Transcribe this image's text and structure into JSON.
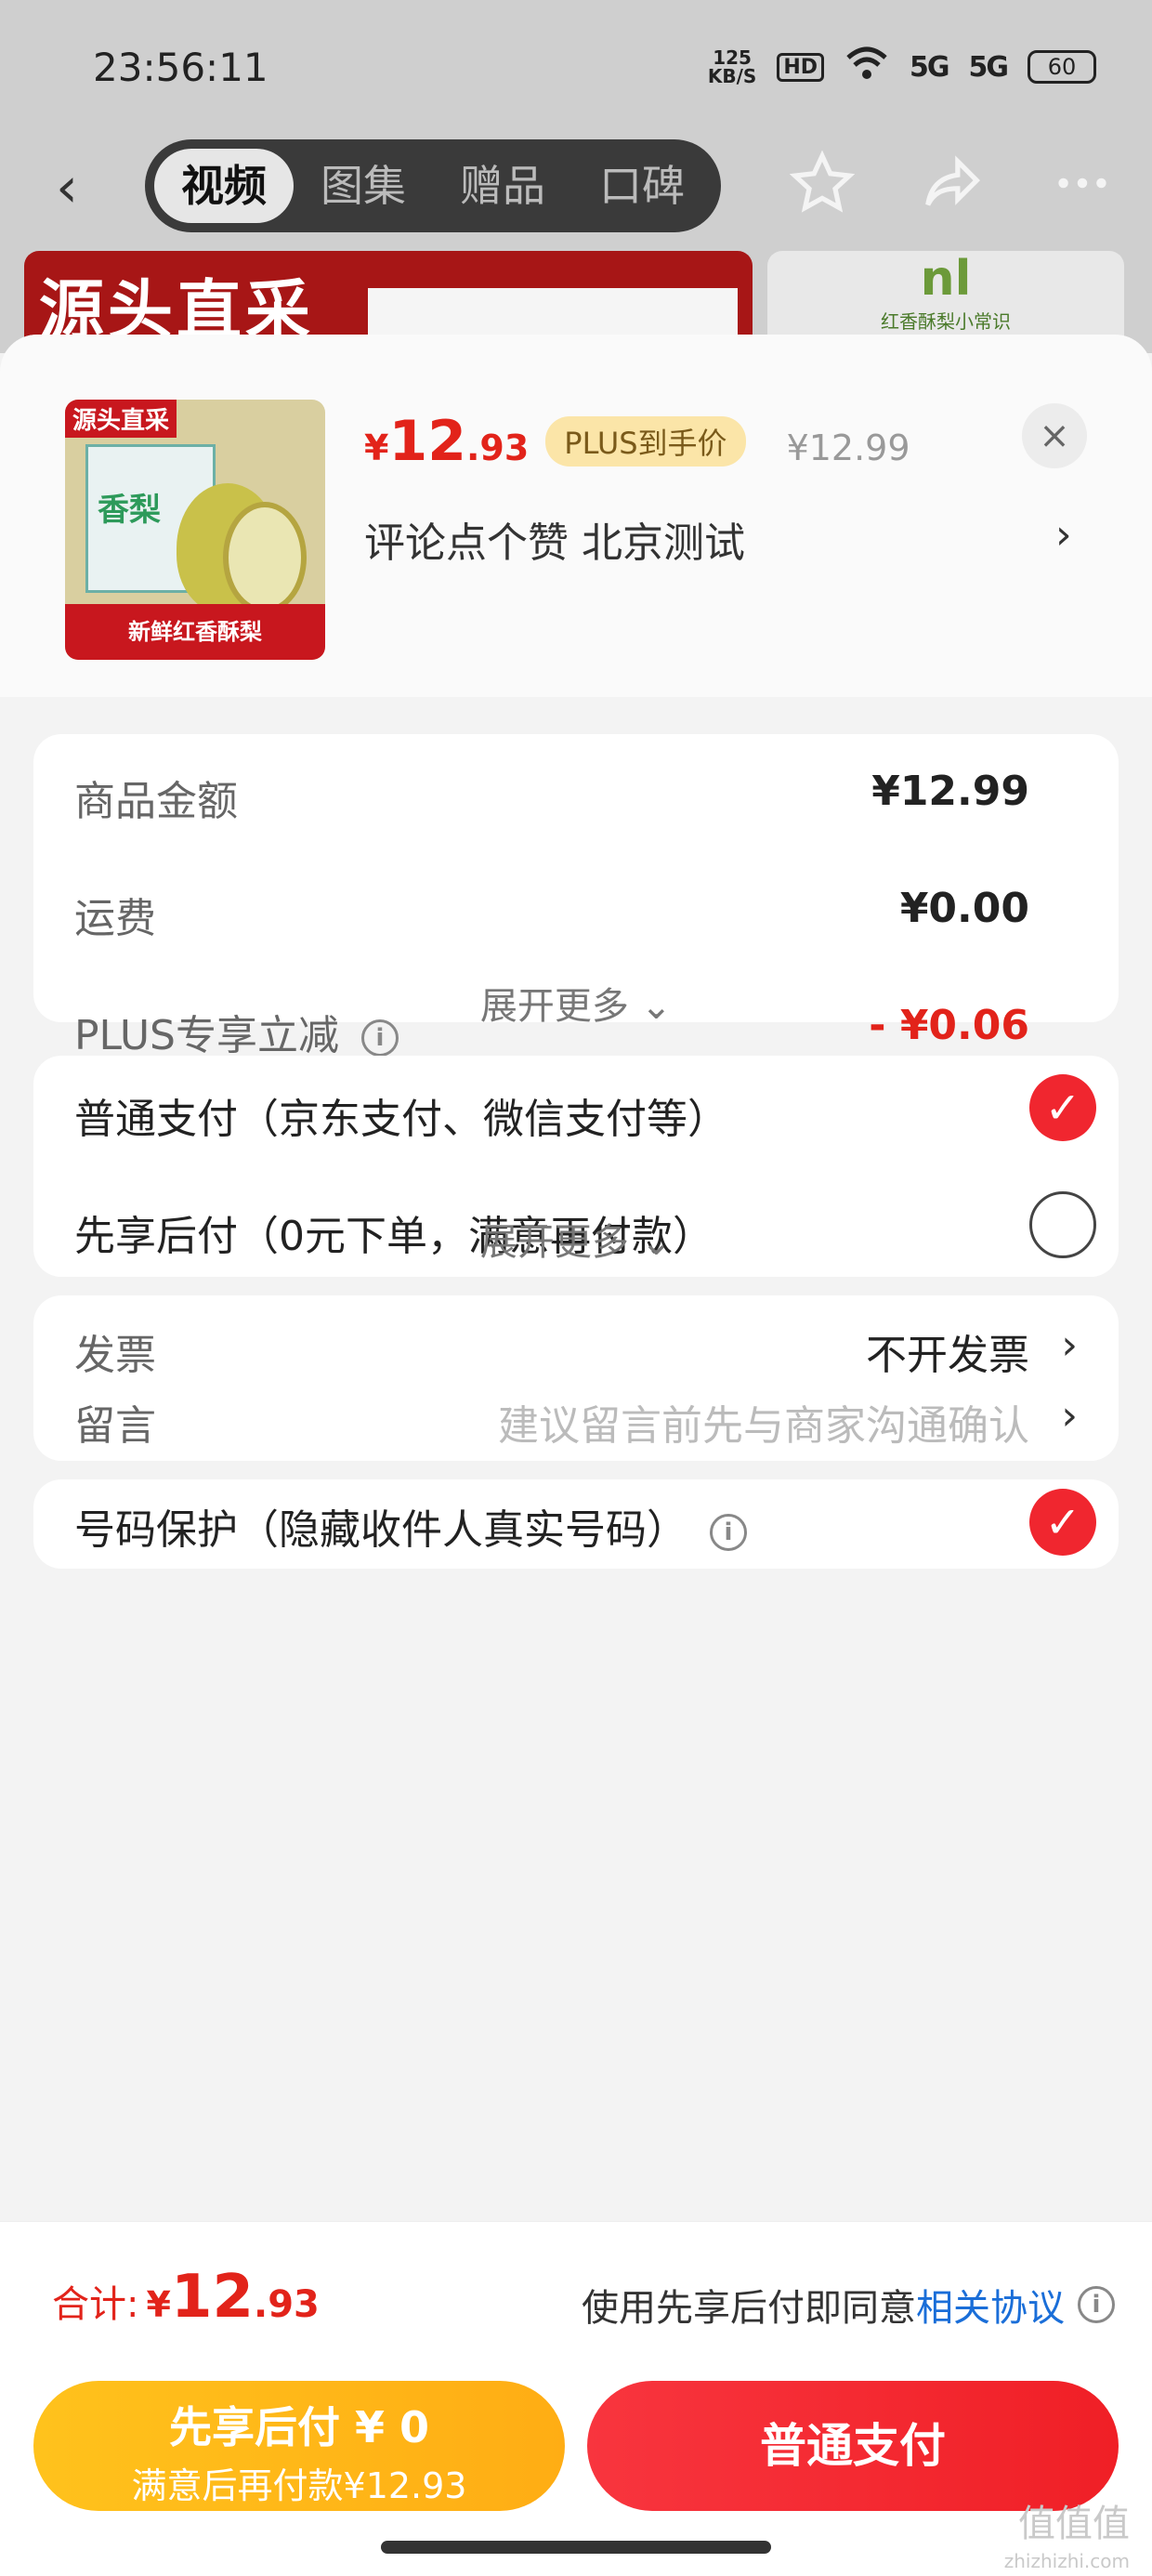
{
  "status_bar": {
    "time": "23:56:11",
    "net_speed_value": "125",
    "net_speed_unit": "KB/S",
    "hd": "HD",
    "signal1": "5G",
    "signal2": "5G",
    "battery": "60"
  },
  "nav": {
    "back": "‹",
    "tabs": [
      "视频",
      "图集",
      "赠品",
      "口碑"
    ],
    "active_tab": "视频"
  },
  "banner": {
    "left_text": "源头直采",
    "right_logo": "nl",
    "right_text": "红香酥梨小常识"
  },
  "product": {
    "thumb_tag": "源头直采",
    "thumb_box_text": "香梨",
    "thumb_bottom": "新鲜红香酥梨",
    "price_symbol": "¥",
    "price_int": "12",
    "price_dec": ".93",
    "plus_badge": "PLUS到手价",
    "original_price": "¥12.99",
    "spec_text": "评论点个赞  北京测试",
    "close": "×"
  },
  "fees": {
    "items": [
      {
        "label": "商品金额",
        "value": "¥12.99"
      },
      {
        "label": "运费",
        "value": "¥0.00"
      },
      {
        "label": "PLUS专享立减",
        "value": "- ¥0.06"
      }
    ],
    "expand": "展开更多 ⌄"
  },
  "payment": {
    "options": [
      {
        "label": "普通支付（京东支付、微信支付等）",
        "selected": true
      },
      {
        "label": "先享后付（0元下单，满意再付款）",
        "selected": false
      }
    ],
    "expand": "展开更多 ⌄"
  },
  "invoice": {
    "label": "发票",
    "value": "不开发票"
  },
  "message": {
    "label": "留言",
    "placeholder": "建议留言前先与商家沟通确认"
  },
  "privacy": {
    "label": "号码保护（隐藏收件人真实号码）",
    "checked": true
  },
  "footer": {
    "total_label": "合计:",
    "total_symbol": "¥",
    "total_int": "12",
    "total_dec": ".93",
    "agree_text": "使用先享后付即同意",
    "agree_link": "相关协议"
  },
  "buttons": {
    "later_line1": "先享后付 ¥ 0",
    "later_line2": "满意后再付款¥12.93",
    "pay": "普通支付"
  },
  "watermark": {
    "main": "值值值",
    "sub": "zhizhizhi.com"
  },
  "colors": {
    "accent_red": "#e2231a",
    "pay_button": "#f01f26",
    "later_button": "#ffad14",
    "link_blue": "#1a6ed8"
  }
}
